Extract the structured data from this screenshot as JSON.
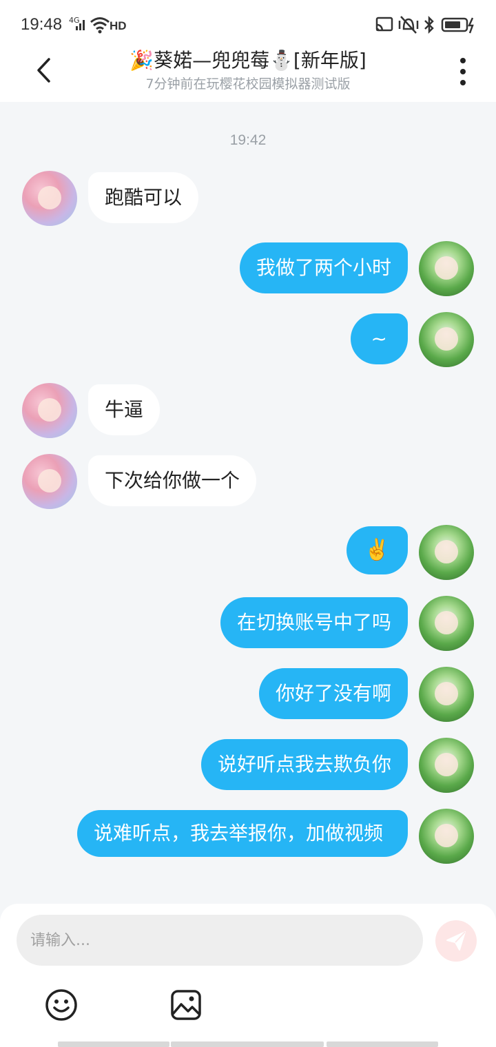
{
  "status_bar": {
    "time": "19:48",
    "network": "4G",
    "wifi_label": "HD",
    "icons": [
      "signal-icon",
      "wifi-icon",
      "cast-icon",
      "vibrate-icon",
      "bluetooth-icon",
      "battery-icon"
    ]
  },
  "header": {
    "title": "🎉葵婼—兜兜莓⛄[新年版]",
    "subtitle": "7分钟前在玩樱花校园模拟器测试版",
    "back_icon": "chevron-left-icon",
    "more_icon": "more-vertical-icon"
  },
  "conversation": {
    "timestamp": "19:42",
    "messages": [
      {
        "side": "in",
        "text": "跑酷可以"
      },
      {
        "side": "out",
        "text": "我做了两个小时"
      },
      {
        "side": "out",
        "text": "~"
      },
      {
        "side": "in",
        "text": "牛逼"
      },
      {
        "side": "in",
        "text": "下次给你做一个"
      },
      {
        "side": "out",
        "text": "✌️"
      },
      {
        "side": "out",
        "text": "在切换账号中了吗"
      },
      {
        "side": "out",
        "text": "你好了没有啊"
      },
      {
        "side": "out",
        "text": "说好听点我去欺负你"
      },
      {
        "side": "out",
        "text": "说难听点，我去举报你，加做视频"
      }
    ]
  },
  "composer": {
    "placeholder": "请输入...",
    "send_icon": "send-icon",
    "tools": [
      "emoji-icon",
      "image-icon"
    ]
  },
  "colors": {
    "outgoing_bubble": "#26b5f5",
    "incoming_bubble": "#ffffff",
    "background": "#f4f6f8",
    "send_button": "#fde6e6"
  }
}
